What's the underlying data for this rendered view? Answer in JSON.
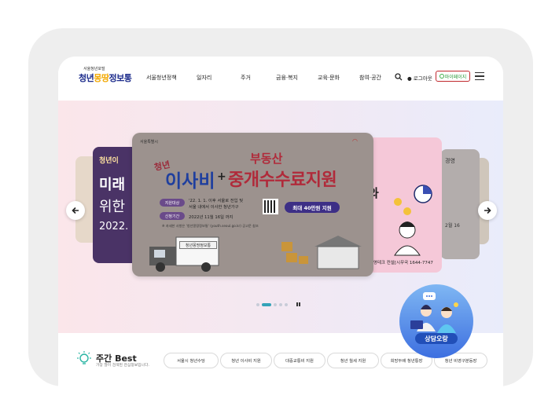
{
  "header": {
    "logo_small": "서울청년포털",
    "logo_part1": "청년",
    "logo_part2": "몽땅",
    "logo_part3": "정보통",
    "nav": [
      "서울청년정책",
      "일자리",
      "주거",
      "금융·복지",
      "교육·문화",
      "참여·공간"
    ],
    "login_label": "로그아웃",
    "mypage_label": "마이페이지"
  },
  "banner_main": {
    "agency": "서울특별시",
    "tag": "청년",
    "headline_1": "이사비",
    "plus": "+",
    "headline_top": "부동산",
    "headline_2": "중개수수료지원",
    "row1_label": "지원대상",
    "row1_text_1": "'22. 1. 1. 이후 서울로 전입 및",
    "row1_text_2": "서울 내에서 이사한 청년가구",
    "row2_label": "신청기간",
    "row2_text": "2022년 11월 16일 까지",
    "amount": "최대 40만원 지원",
    "note": "※ 자세한 사항은 '청년몽땅정보통' (youth.seoul.go.kr) 공고문 참조",
    "truck_label": "청년몽땅정보통"
  },
  "banner_left": {
    "line1": "청년이",
    "line2": "미래",
    "line3": "위한",
    "line4": "2022."
  },
  "banner_right": {
    "line1": "와",
    "line2": "을 영테크 컨설[시무국 1644-7747"
  },
  "banner_right2": {
    "line1": "경영",
    "line2": "2월 16"
  },
  "carousel": {
    "total_slides": 5,
    "active_slide": 2
  },
  "chat": {
    "label": "상담오랑"
  },
  "best": {
    "title": "주간 Best",
    "subtitle": "가장 많이 검색된 관심정보입니다.",
    "tags": [
      "서울시 청년수당",
      "청년 이사비 지원",
      "대중교통비 지원",
      "청년 월세 지원",
      "희망두배 청년통장",
      "청년 비영구분등장"
    ]
  },
  "colors": {
    "brand_blue": "#1d2c8c",
    "brand_yellow": "#f2a800",
    "mypage_border": "#c0282d",
    "active_dot": "#34a3b8",
    "chat_blue": "#214fb8"
  }
}
